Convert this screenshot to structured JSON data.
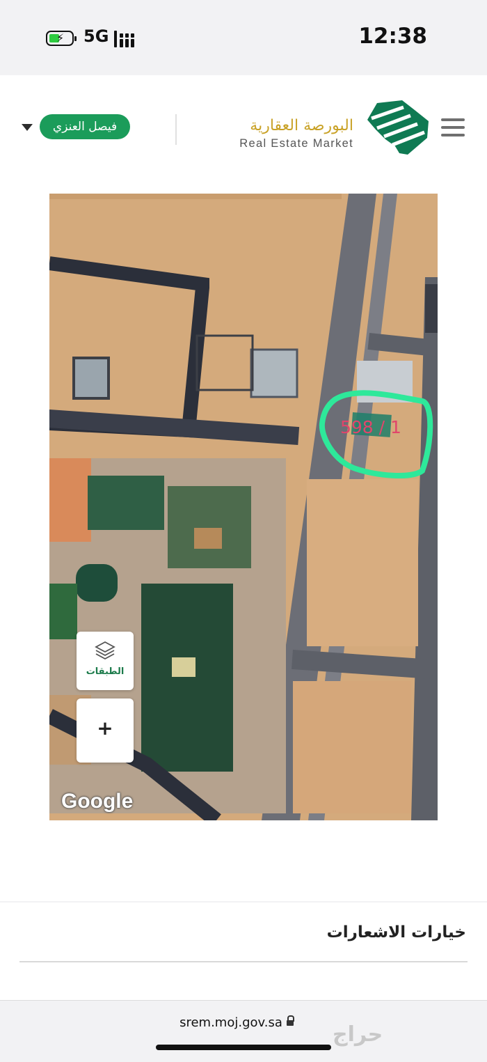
{
  "status_bar": {
    "time": "12:38",
    "network": "5G",
    "icons": [
      "battery-charging-icon",
      "signal-icon"
    ]
  },
  "header": {
    "brand_ar": "البورصة العقارية",
    "brand_en": "Real Estate Market",
    "user_name": "فيصل العنزي",
    "icons": [
      "menu-icon",
      "logo-icon",
      "chevron-down-icon"
    ],
    "accent_color": "#1b9c5a",
    "brand_gold": "#c9a227"
  },
  "map": {
    "parcel_label": "598 / 1",
    "layers_label": "الطبقات",
    "zoom_in_label": "+",
    "attribution": "Google",
    "highlight_color": "#2ee89a"
  },
  "notifications": {
    "title": "خيارات الاشعارات"
  },
  "browser": {
    "url": "srem.moj.gov.sa",
    "watermark": "حراج"
  }
}
